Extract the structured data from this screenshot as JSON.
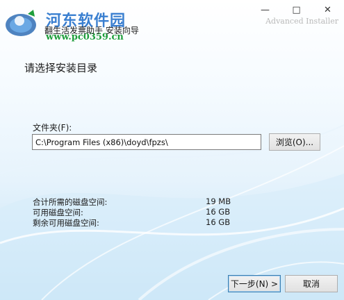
{
  "window": {
    "title": "翻生活发票助手 安装向导",
    "subtitle": "Advanced Installer",
    "controls": {
      "minimize": "—",
      "maximize": "□",
      "close": "✕"
    }
  },
  "watermark": {
    "site_name": "河东软件园",
    "url": "www.pc0359.cn"
  },
  "page": {
    "heading": "请选择安装目录"
  },
  "folder": {
    "label": "文件夹(F):",
    "value": "C:\\Program Files (x86)\\doyd\\fpzs\\",
    "browse_label": "浏览(O)..."
  },
  "disk_space": [
    {
      "label": "合计所需的磁盘空间:",
      "value": "19 MB"
    },
    {
      "label": "可用磁盘空间:",
      "value": "16 GB"
    },
    {
      "label": "剩余可用磁盘空间:",
      "value": "16 GB"
    }
  ],
  "footer": {
    "next_label": "下一步(N) >",
    "cancel_label": "取消"
  },
  "colors": {
    "accent": "#3c7fb1",
    "watermark_blue": "#3a7fd0",
    "watermark_green": "#1f9e3c",
    "background_bottom": "#bfe0f5"
  },
  "icons": [
    "installer-logo-icon",
    "minimize-icon",
    "maximize-icon",
    "close-icon"
  ]
}
